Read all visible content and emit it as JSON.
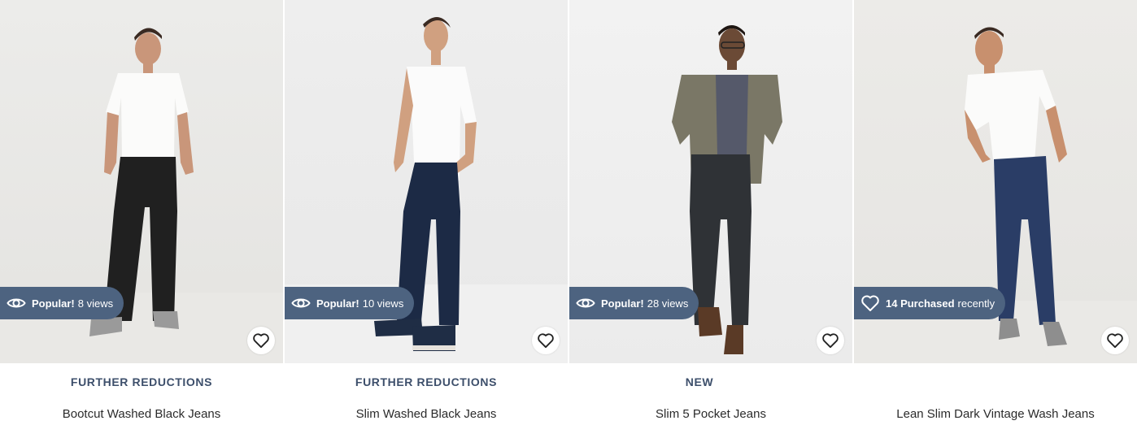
{
  "products": [
    {
      "badge": {
        "icon": "eye-icon",
        "strong": "Popular!",
        "rest": "8 views"
      },
      "tag": "FURTHER REDUCTIONS",
      "name": "Bootcut Washed Black Jeans",
      "image": "man-white-henley-black-bootcut-jeans"
    },
    {
      "badge": {
        "icon": "eye-icon",
        "strong": "Popular!",
        "rest": "10 views"
      },
      "tag": "FURTHER REDUCTIONS",
      "name": "Slim Washed Black Jeans",
      "image": "man-white-tee-navy-slim-jeans"
    },
    {
      "badge": {
        "icon": "eye-icon",
        "strong": "Popular!",
        "rest": "28 views"
      },
      "tag": "NEW",
      "name": "Slim 5 Pocket Jeans",
      "image": "man-olive-jacket-charcoal-jeans"
    },
    {
      "badge": {
        "icon": "heart-icon",
        "strong": "14 Purchased",
        "rest": "recently"
      },
      "tag": "",
      "name": "Lean Slim Dark Vintage Wash Jeans",
      "image": "man-white-tee-dark-blue-jeans"
    }
  ],
  "favourite_icon": "heart-outline-icon",
  "colors": {
    "badge_bg": "#4d6380",
    "tag_text": "#3d4f6b",
    "name_text": "#2b2b2b"
  }
}
